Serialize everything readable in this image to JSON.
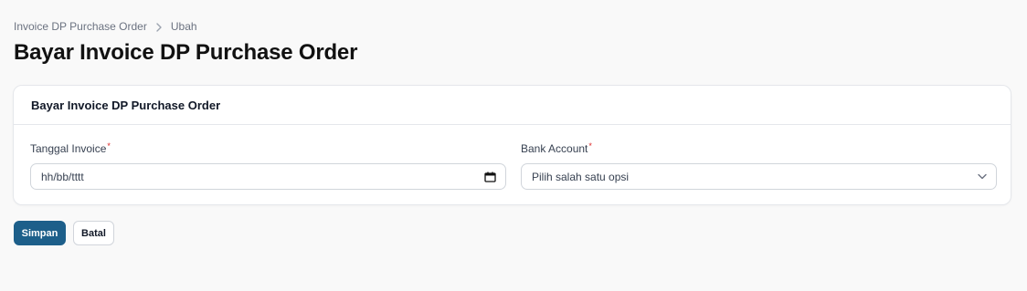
{
  "breadcrumb": {
    "items": [
      "Invoice DP Purchase Order",
      "Ubah"
    ]
  },
  "page": {
    "title": "Bayar Invoice DP Purchase Order"
  },
  "card": {
    "title": "Bayar Invoice DP Purchase Order"
  },
  "form": {
    "tanggal_invoice": {
      "label": "Tanggal Invoice",
      "required_mark": "*",
      "value": "hh/bb/tttt",
      "icon": "calendar-icon"
    },
    "bank_account": {
      "label": "Bank Account",
      "required_mark": "*",
      "value": "Pilih salah satu opsi",
      "icon": "chevron-down-icon"
    }
  },
  "actions": {
    "save_label": "Simpan",
    "cancel_label": "Batal"
  },
  "colors": {
    "primary": "#1d5f8a",
    "required": "#dc2626",
    "background": "#f9f9f9"
  }
}
